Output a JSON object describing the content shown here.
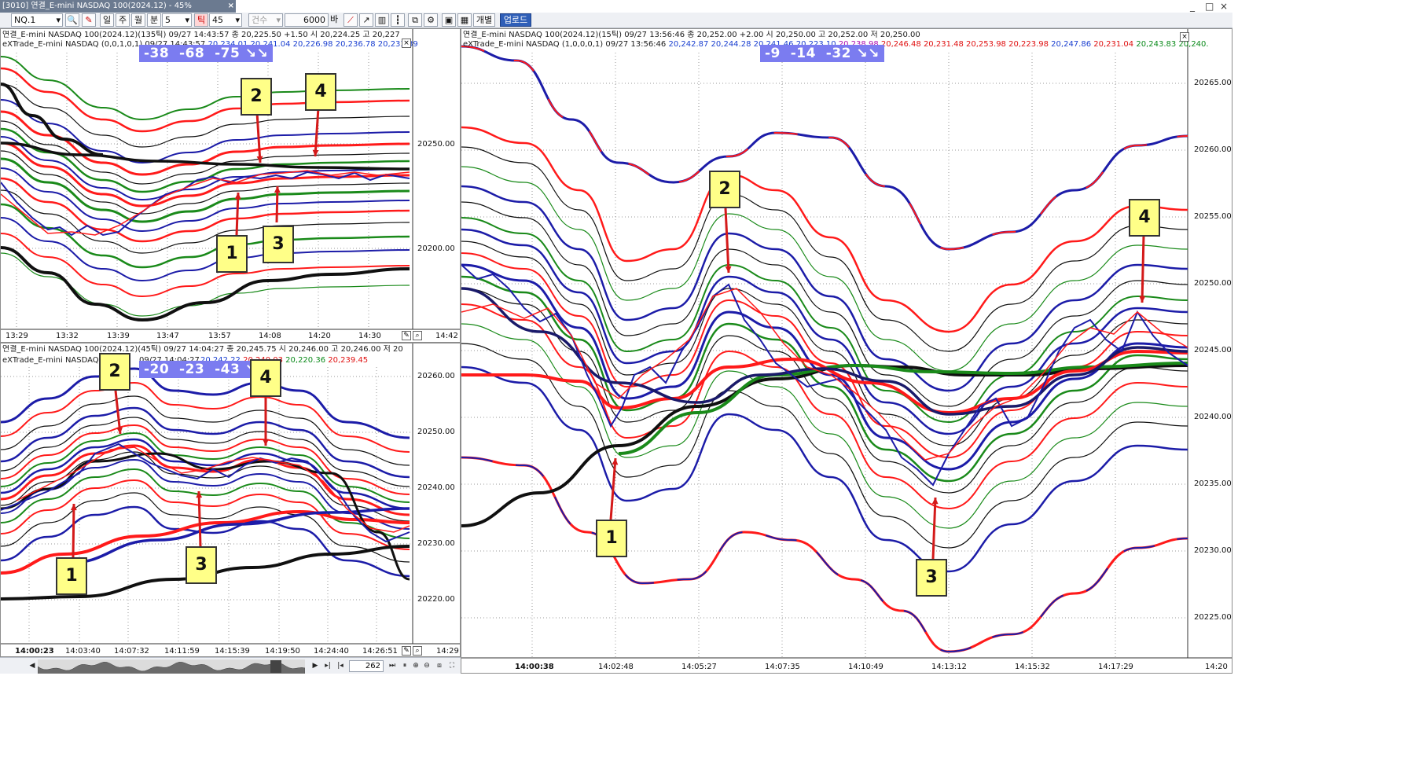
{
  "window": {
    "title": "[3010] 연결_E-mini NASDAQ 100(2024.12) - 45%",
    "controls": [
      "_",
      "□",
      "×"
    ]
  },
  "toolbar": {
    "item_code": "NQ.1",
    "btn_day": "일",
    "btn_week": "주",
    "btn_month": "월",
    "btn_minute": "분",
    "minute_value": "5",
    "btn_tick": "틱",
    "tick_value": "45",
    "btn_count": "건수",
    "count_value": "6000",
    "btn_ba": "바",
    "btn_individual": "개별",
    "btn_upload": "업로드"
  },
  "panels": {
    "top_left": {
      "header": "연결_E-mini NASDAQ 100(2024.12)(135틱) 09/27 14:43:57   종 20,225.50 +1.50   시 20,224.25  고 20,227",
      "indicator": "eXTrade_E-mini NASDAQ  (0,0,1,0,1)  09/27 14:43:57",
      "values": [
        {
          "text": "20,234.01",
          "color": "#1a3fd0"
        },
        {
          "text": "20,241.04",
          "color": "#1a3fd0"
        },
        {
          "text": "20,226.98",
          "color": "#1a3fd0"
        },
        {
          "text": "20,236.78",
          "color": "#1a3fd0"
        },
        {
          "text": "20,233.39",
          "color": "#1a3fd0"
        }
      ],
      "badge": "-38  -68  -75 ↘↘",
      "y_ticks": [
        "20250.00",
        "20200.00"
      ],
      "x_ticks": [
        "13:29",
        "13:32",
        "13:39",
        "13:47",
        "13:57",
        "14:08",
        "14:20",
        "14:30",
        "14:42"
      ],
      "callouts": [
        "2",
        "4",
        "1",
        "3"
      ]
    },
    "bottom_left": {
      "header": "연결_E-mini NASDAQ 100(2024.12)(45틱) 09/27 14:04:27   종 20,245.75   시 20,246.00  고 20,246.00  저 20",
      "indicator": "eXTrade_E-mini NASDAQ",
      "indicator_meta": "09/27 14:04:27",
      "values": [
        {
          "text": "20,242.22",
          "color": "#1a3fd0"
        },
        {
          "text": "20,240.03",
          "color": "#e01010"
        },
        {
          "text": "20,220.36",
          "color": "#0a8a1a"
        },
        {
          "text": "20,239.45",
          "color": "#e01010"
        }
      ],
      "badge": "-20  -23  -43 ↘↘",
      "y_ticks": [
        "20260.00",
        "20250.00",
        "20240.00",
        "20230.00",
        "20220.00"
      ],
      "x_ticks": [
        "14:00:23",
        "14:03:40",
        "14:07:32",
        "14:11:59",
        "14:15:39",
        "14:19:50",
        "14:24:40",
        "14:26:51",
        "14:29"
      ],
      "callouts": [
        "2",
        "4",
        "1",
        "3"
      ]
    },
    "right": {
      "header": "연결_E-mini NASDAQ 100(2024.12)(15틱) 09/27 13:56:46   종 20,252.00 +2.00   시 20,250.00  고 20,252.00  저 20,250.00",
      "indicator": "eXTrade_E-mini NASDAQ  (1,0,0,0,1)  09/27 13:56:46",
      "values": [
        {
          "text": "20,242.87",
          "color": "#1a3fd0"
        },
        {
          "text": "20,244.28",
          "color": "#1a3fd0"
        },
        {
          "text": "20,241.46",
          "color": "#1a3fd0"
        },
        {
          "text": "20,223.10",
          "color": "#1a3fd0"
        },
        {
          "text": "20,238.98",
          "color": "#b010b0"
        },
        {
          "text": "20,246.48",
          "color": "#e01010"
        },
        {
          "text": "20,231.48",
          "color": "#e01010"
        },
        {
          "text": "20,253.98",
          "color": "#e01010"
        },
        {
          "text": "20,223.98",
          "color": "#e01010"
        },
        {
          "text": "20,247.86",
          "color": "#1a3fd0"
        },
        {
          "text": "20,231.04",
          "color": "#e01010"
        },
        {
          "text": "20,243.83",
          "color": "#0a8a1a"
        },
        {
          "text": "20,240.",
          "color": "#0a8a1a"
        }
      ],
      "badge": "-9  -14  -32 ↘↘",
      "y_ticks": [
        "20265.00",
        "20260.00",
        "20255.00",
        "20250.00",
        "20245.00",
        "20240.00",
        "20235.00",
        "20230.00",
        "20225.00"
      ],
      "x_ticks": [
        "14:00:38",
        "14:02:48",
        "14:05:27",
        "14:07:35",
        "14:10:49",
        "14:13:12",
        "14:15:32",
        "14:17:29",
        "14:20"
      ],
      "callouts": [
        "2",
        "4",
        "1",
        "3"
      ]
    }
  },
  "statusbar": {
    "count": "262"
  },
  "colors": {
    "red": "#ff1a1a",
    "blue": "#1c1ca8",
    "green": "#1a8a1a",
    "black": "#101010",
    "badge": "#7b7cf0"
  }
}
